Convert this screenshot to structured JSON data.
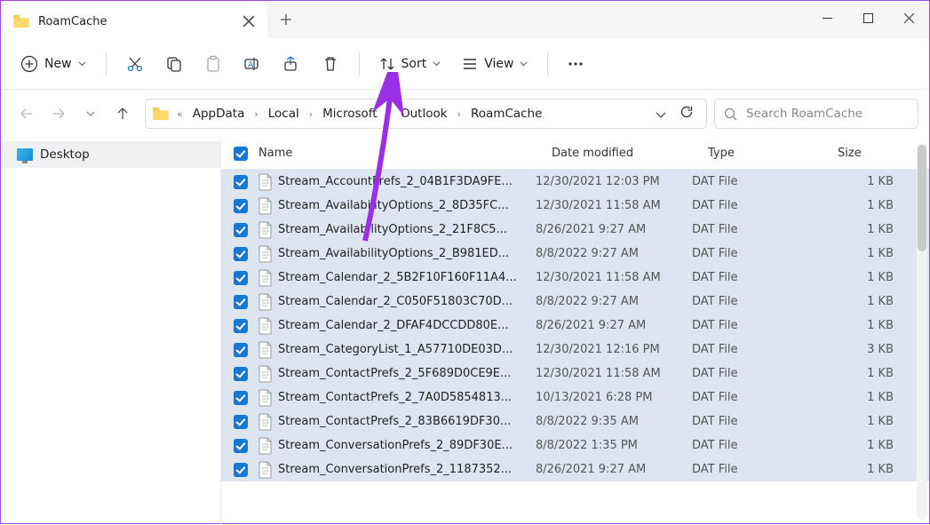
{
  "window": {
    "tab_title": "RoamCache"
  },
  "toolbar": {
    "new_label": "New",
    "sort_label": "Sort",
    "view_label": "View"
  },
  "breadcrumb": {
    "items": [
      "AppData",
      "Local",
      "Microsoft",
      "Outlook",
      "RoamCache"
    ]
  },
  "search": {
    "placeholder": "Search RoamCache"
  },
  "sidebar": {
    "items": [
      {
        "label": "Desktop"
      }
    ]
  },
  "columns": {
    "name": "Name",
    "date": "Date modified",
    "type": "Type",
    "size": "Size"
  },
  "files": [
    {
      "name": "Stream_AccountPrefs_2_04B1F3DA9FE...",
      "date": "12/30/2021 12:03 PM",
      "type": "DAT File",
      "size": "1 KB"
    },
    {
      "name": "Stream_AvailabilityOptions_2_8D35FC...",
      "date": "12/30/2021 11:58 AM",
      "type": "DAT File",
      "size": "1 KB"
    },
    {
      "name": "Stream_AvailabilityOptions_2_21F8C5...",
      "date": "8/26/2021 9:27 AM",
      "type": "DAT File",
      "size": "1 KB"
    },
    {
      "name": "Stream_AvailabilityOptions_2_B981ED...",
      "date": "8/8/2022 9:27 AM",
      "type": "DAT File",
      "size": "1 KB"
    },
    {
      "name": "Stream_Calendar_2_5B2F10F160F11A4...",
      "date": "12/30/2021 11:58 AM",
      "type": "DAT File",
      "size": "1 KB"
    },
    {
      "name": "Stream_Calendar_2_C050F51803C70D...",
      "date": "8/8/2022 9:27 AM",
      "type": "DAT File",
      "size": "1 KB"
    },
    {
      "name": "Stream_Calendar_2_DFAF4DCCDD80E...",
      "date": "8/26/2021 9:27 AM",
      "type": "DAT File",
      "size": "1 KB"
    },
    {
      "name": "Stream_CategoryList_1_A57710DE03D...",
      "date": "12/30/2021 12:16 PM",
      "type": "DAT File",
      "size": "3 KB"
    },
    {
      "name": "Stream_ContactPrefs_2_5F689D0CE9E...",
      "date": "12/30/2021 11:58 AM",
      "type": "DAT File",
      "size": "1 KB"
    },
    {
      "name": "Stream_ContactPrefs_2_7A0D5854813...",
      "date": "10/13/2021 6:28 PM",
      "type": "DAT File",
      "size": "1 KB"
    },
    {
      "name": "Stream_ContactPrefs_2_83B6619DF30...",
      "date": "8/8/2022 9:35 AM",
      "type": "DAT File",
      "size": "1 KB"
    },
    {
      "name": "Stream_ConversationPrefs_2_89DF30E...",
      "date": "8/8/2022 1:35 PM",
      "type": "DAT File",
      "size": "1 KB"
    },
    {
      "name": "Stream_ConversationPrefs_2_1187352...",
      "date": "8/26/2021 9:27 AM",
      "type": "DAT File",
      "size": "1 KB"
    }
  ]
}
